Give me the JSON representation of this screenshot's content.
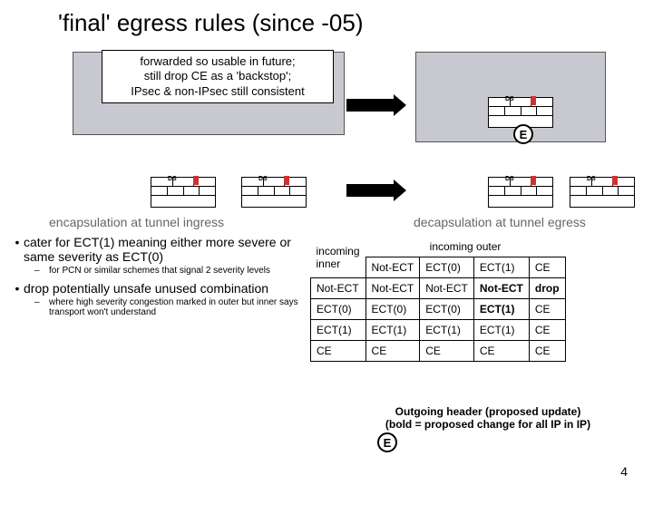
{
  "title": "'final' egress rules (since -05)",
  "callout": "forwarded so usable in future;\nstill drop CE as a 'backstop';\nIPsec & non-IPsec still consistent",
  "ecircle": "E",
  "ds": "DS",
  "sections": {
    "left_heading": "encapsulation at tunnel ingress",
    "right_heading": "decapsulation at tunnel egress"
  },
  "bullets": {
    "b1": "cater for ECT(1) meaning either more severe or same severity as ECT(0)",
    "s1": "for PCN or similar schemes that signal 2 severity levels",
    "b2": "drop potentially unsafe unused combination",
    "s2": "where high severity congestion marked in outer but inner says transport won't understand"
  },
  "table": {
    "inner_label": "incoming\ninner",
    "outer_label": "incoming outer",
    "cols": [
      "Not-ECT",
      "ECT(0)",
      "ECT(1)",
      "CE"
    ],
    "rows": [
      {
        "h": "Not-ECT",
        "c": [
          "Not-ECT",
          "Not-ECT",
          "Not-ECT",
          "drop"
        ],
        "bold": [
          false,
          false,
          true,
          true
        ]
      },
      {
        "h": "ECT(0)",
        "c": [
          "ECT(0)",
          "ECT(0)",
          "ECT(1)",
          "CE"
        ],
        "bold": [
          false,
          false,
          true,
          false
        ]
      },
      {
        "h": "ECT(1)",
        "c": [
          "ECT(1)",
          "ECT(1)",
          "ECT(1)",
          "CE"
        ],
        "bold": [
          false,
          false,
          false,
          false
        ]
      },
      {
        "h": "CE",
        "c": [
          "CE",
          "CE",
          "CE",
          "CE"
        ],
        "bold": [
          false,
          false,
          false,
          false
        ]
      }
    ]
  },
  "caption": "Outgoing header (proposed update)\n(bold = proposed change for all IP in IP)",
  "page": "4"
}
